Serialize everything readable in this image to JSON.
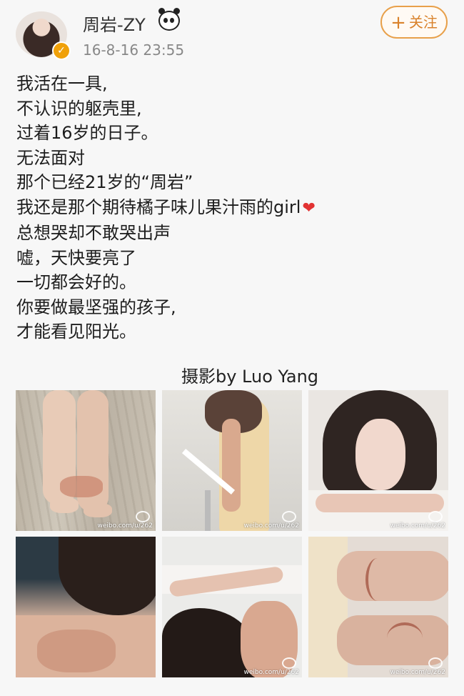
{
  "header": {
    "username": "周岩-ZY",
    "timestamp": "16-8-16 23:55",
    "verified_icon": "verified-badge-icon",
    "follow_label": "关注",
    "follow_plus": "+"
  },
  "post": {
    "lines": [
      "我活在一具,",
      "不认识的躯壳里,",
      "过着16岁的日子。",
      "无法面对",
      "那个已经21岁的“周岩”",
      "我还是那个期待橘子味儿果汁雨的girl",
      "总想哭却不敢哭出声",
      "嘘，天快要亮了",
      "一切都会好的。",
      "你要做最坚强的孩子,",
      "才能看见阳光。"
    ],
    "heart": "❤"
  },
  "credit": "摄影by Luo Yang",
  "photos": [
    {
      "watermark": "weibo.com/u/262"
    },
    {
      "watermark": "weibo.com/u/262"
    },
    {
      "watermark": "weibo.com/u/262"
    },
    {
      "watermark": ""
    },
    {
      "watermark": "weibo.com/u/262"
    },
    {
      "watermark": "weibo.com/u/262"
    }
  ],
  "colors": {
    "accent": "#e8a04a",
    "heart": "#e23333",
    "background": "#f7f7f7"
  }
}
